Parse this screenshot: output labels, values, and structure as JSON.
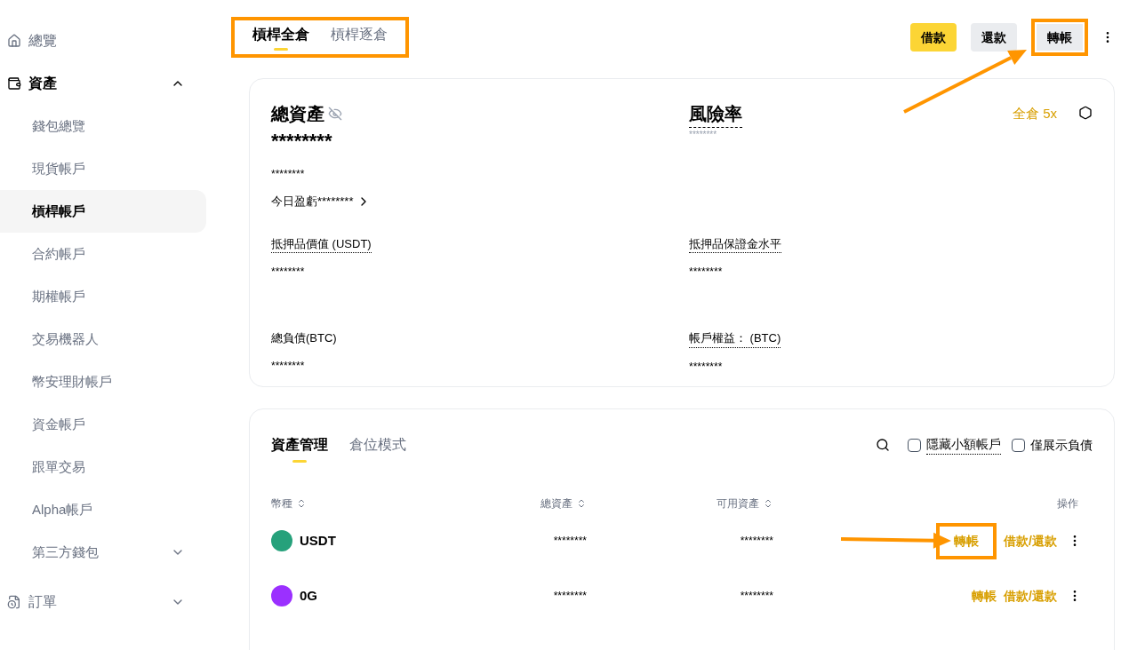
{
  "sidebar": [
    {
      "label": "總覽",
      "kind": "home"
    },
    {
      "label": "資產",
      "kind": "wallet",
      "expanded": true,
      "children": [
        {
          "label": "錢包總覽",
          "selected": false
        },
        {
          "label": "現貨帳戶",
          "selected": false
        },
        {
          "label": "槓桿帳戶",
          "selected": true
        },
        {
          "label": "合約帳戶",
          "selected": false
        },
        {
          "label": "期權帳戶",
          "selected": false
        },
        {
          "label": "交易機器人",
          "selected": false
        },
        {
          "label": "幣安理財帳戶",
          "selected": false
        },
        {
          "label": "資金帳戶",
          "selected": false
        },
        {
          "label": "跟單交易",
          "selected": false
        },
        {
          "label": "Alpha帳戶",
          "selected": false
        },
        {
          "label": "第三方錢包",
          "selected": false,
          "expanded": false
        }
      ]
    },
    {
      "label": "訂單",
      "kind": "orders",
      "expanded": false
    }
  ],
  "margin_tabs": {
    "highlighted": true,
    "items": [
      {
        "label": "槓桿全倉",
        "selected": true
      },
      {
        "label": "槓桿逐倉",
        "selected": false
      }
    ]
  },
  "header_buttons": [
    {
      "label": "借款",
      "kind": "primary",
      "highlighted": false
    },
    {
      "label": "還款",
      "kind": "secondary",
      "highlighted": false
    },
    {
      "label": "轉帳",
      "kind": "secondary",
      "highlighted": true
    }
  ],
  "summary": {
    "total_label": "總資產",
    "total_value": "********",
    "total_sub": "********",
    "pnl": "今日盈虧********",
    "risk_label": "風險率",
    "risk_value": "********",
    "mode": "全倉 5x",
    "fields": [
      {
        "label": "抵押品價值 (USDT)",
        "value": "********",
        "dotted": true
      },
      {
        "label": "抵押品保證金水平",
        "value": "********",
        "dotted": true
      },
      {
        "label": "總負債(BTC)",
        "value": "********",
        "dotted": false
      },
      {
        "label": "帳戶權益： (BTC)",
        "value": "********",
        "dotted": true
      }
    ]
  },
  "assets": {
    "tabs": [
      {
        "label": "資產管理",
        "selected": true
      },
      {
        "label": "倉位模式",
        "selected": false
      }
    ],
    "hide_small": {
      "label": "隱藏小額帳戶",
      "checked": false
    },
    "debt_only": {
      "label": "僅展示負債",
      "checked": false
    },
    "columns": [
      {
        "label": "幣種",
        "sortable": true
      },
      {
        "label": "總資產",
        "sortable": true
      },
      {
        "label": "可用資產",
        "sortable": true
      },
      {
        "label": "操作",
        "sortable": false
      }
    ],
    "rows": [
      {
        "coin": "USDT",
        "color": "#26a17b",
        "total": "********",
        "available": "********",
        "transfer": "轉帳",
        "borrow": "借款/還款",
        "highlighted": true
      },
      {
        "coin": "0G",
        "color": "#9b30ff",
        "total": "********",
        "available": "********",
        "transfer": "轉帳",
        "borrow": "借款/還款",
        "highlighted": false
      }
    ]
  }
}
